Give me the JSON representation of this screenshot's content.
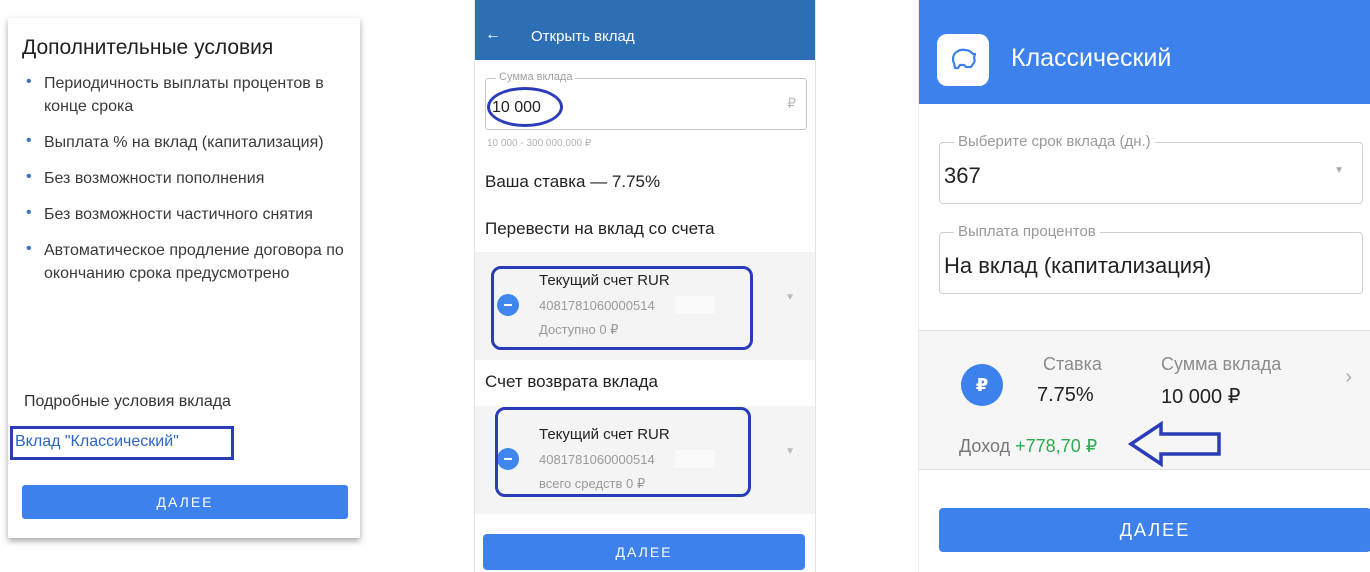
{
  "panel1": {
    "title": "Дополнительные условия",
    "bullets": [
      "Периодичность выплаты процентов в конце срока",
      "Выплата % на вклад (капитализация)",
      "Без возможности пополнения",
      "Без возможности частичного снятия",
      "Автоматическое продление договора по окончанию срока предусмотрено"
    ],
    "details_label": "Подробные условия вклада",
    "link": "Вклад \"Классический\"",
    "button": "ДАЛЕЕ"
  },
  "panel2": {
    "back_icon": "←",
    "title": "Открыть вклад",
    "amount_label": "Сумма вклада",
    "amount_value": "10 000",
    "currency": "₽",
    "range": "10 000 - 300 000 000 ₽",
    "rate": "Ваша ставка — 7.75%",
    "transfer_heading": "Перевести на вклад со счета",
    "from_account": {
      "name": "Текущий счет RUR",
      "number": "4081781060000514",
      "available": "Доступно 0 ₽"
    },
    "return_heading": "Счет возврата вклада",
    "return_account": {
      "name": "Текущий счет RUR",
      "number": "4081781060000514",
      "available": "всего средств 0 ₽"
    },
    "button": "ДАЛЕЕ"
  },
  "panel3": {
    "title": "Классический",
    "term_label": "Выберите срок вклада (дн.)",
    "term_value": "367",
    "payout_label": "Выплата процентов",
    "payout_value": "На вклад (капитализация)",
    "coin": "₽",
    "rate_label": "Ставка",
    "rate_value": "7.75%",
    "sum_label": "Сумма вклада",
    "sum_value": "10 000 ₽",
    "income_label": "Доход",
    "income_value": "+778,70 ₽",
    "chevron": "›",
    "button": "ДАЛЕЕ"
  },
  "colors": {
    "accent": "#3d82ec",
    "header_dark": "#2d6fb4",
    "annotation": "#2b3cb8",
    "income": "#2eaa4f"
  }
}
